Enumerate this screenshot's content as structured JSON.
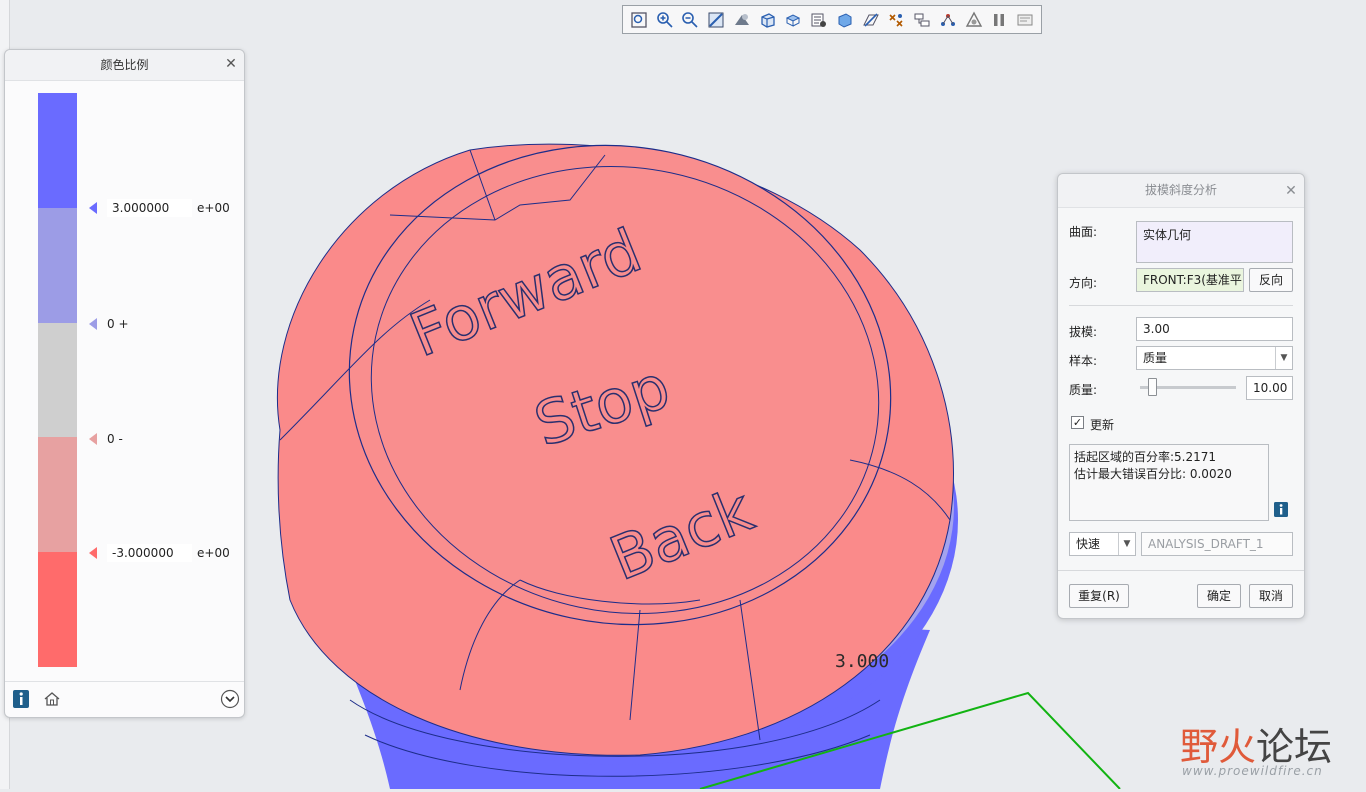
{
  "toolbar": {
    "icons": [
      "zoom-fit-icon",
      "zoom-in-icon",
      "zoom-out-icon",
      "repaint-icon",
      "shading-icon",
      "view-cube-icon",
      "saved-views-icon",
      "display-style-icon",
      "perspective-icon",
      "datum-display-icon",
      "annotation-display-icon",
      "filters-icon",
      "spin-center-icon",
      "appearance-icon",
      "pause-icon",
      "palette-icon"
    ]
  },
  "color_scale": {
    "title": "颜色比例",
    "colors": [
      "#6a6bff",
      "#9c9ce6",
      "#cfcfcf",
      "#e7a1a1",
      "#ff6b6b"
    ],
    "ticks": [
      {
        "value": "3.000000",
        "exp": "e+00",
        "color": "#6a6bff"
      },
      {
        "label": "0 +",
        "color": "#9c9ce6"
      },
      {
        "label": "0 -",
        "color": "#e7a1a1"
      },
      {
        "value": "-3.000000",
        "exp": "e+00",
        "color": "#ff6b6b"
      }
    ]
  },
  "model": {
    "embossed_text": [
      "Forward",
      "Stop",
      "Back"
    ],
    "dimension": "3.000"
  },
  "draft_dialog": {
    "title": "拔模斜度分析",
    "surface_label": "曲面:",
    "surface_value": "实体几何",
    "direction_label": "方向:",
    "direction_value": "FRONT:F3(基准平",
    "reverse_button": "反向",
    "draft_label": "拔模:",
    "draft_value": "3.00",
    "sample_label": "样本:",
    "sample_value": "质量",
    "quality_label": "质量:",
    "quality_value": "10.00",
    "quality_slider": 0.1,
    "update_label": "更新",
    "update_checked": true,
    "result_line1": "括起区域的百分率:5.2171",
    "result_line2": "估计最大错误百分比: 0.0020",
    "mode_value": "快速",
    "analysis_name": "ANALYSIS_DRAFT_1",
    "repeat_button": "重复(R)",
    "ok_button": "确定",
    "cancel_button": "取消"
  },
  "watermark": {
    "part1": "野火",
    "part2": "论坛",
    "url": "www.proewildfire.cn"
  }
}
